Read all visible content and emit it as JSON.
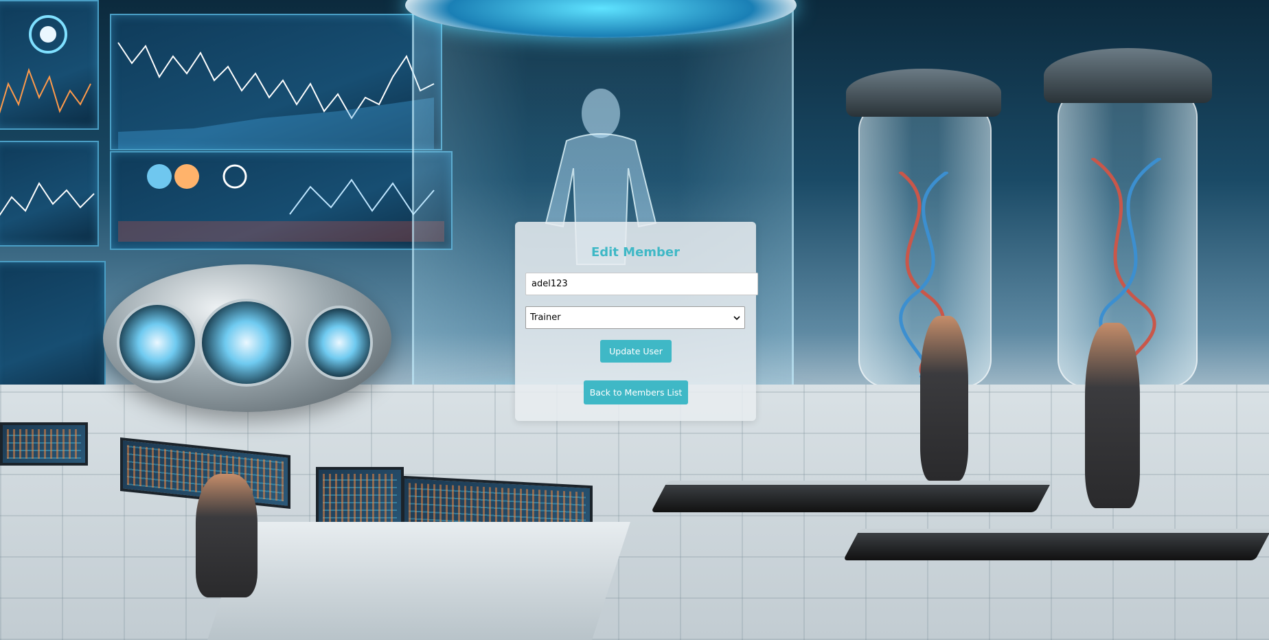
{
  "form": {
    "title": "Edit Member",
    "username_value": "adel123",
    "role_selected": "Trainer",
    "update_label": "Update User",
    "back_label": "Back to Members List"
  },
  "icons": {
    "select_arrow": "chevron-down-icon"
  },
  "colors": {
    "accent": "#3fb8c6",
    "card_background": "#e8ecf0",
    "button_text": "#ffffff"
  }
}
